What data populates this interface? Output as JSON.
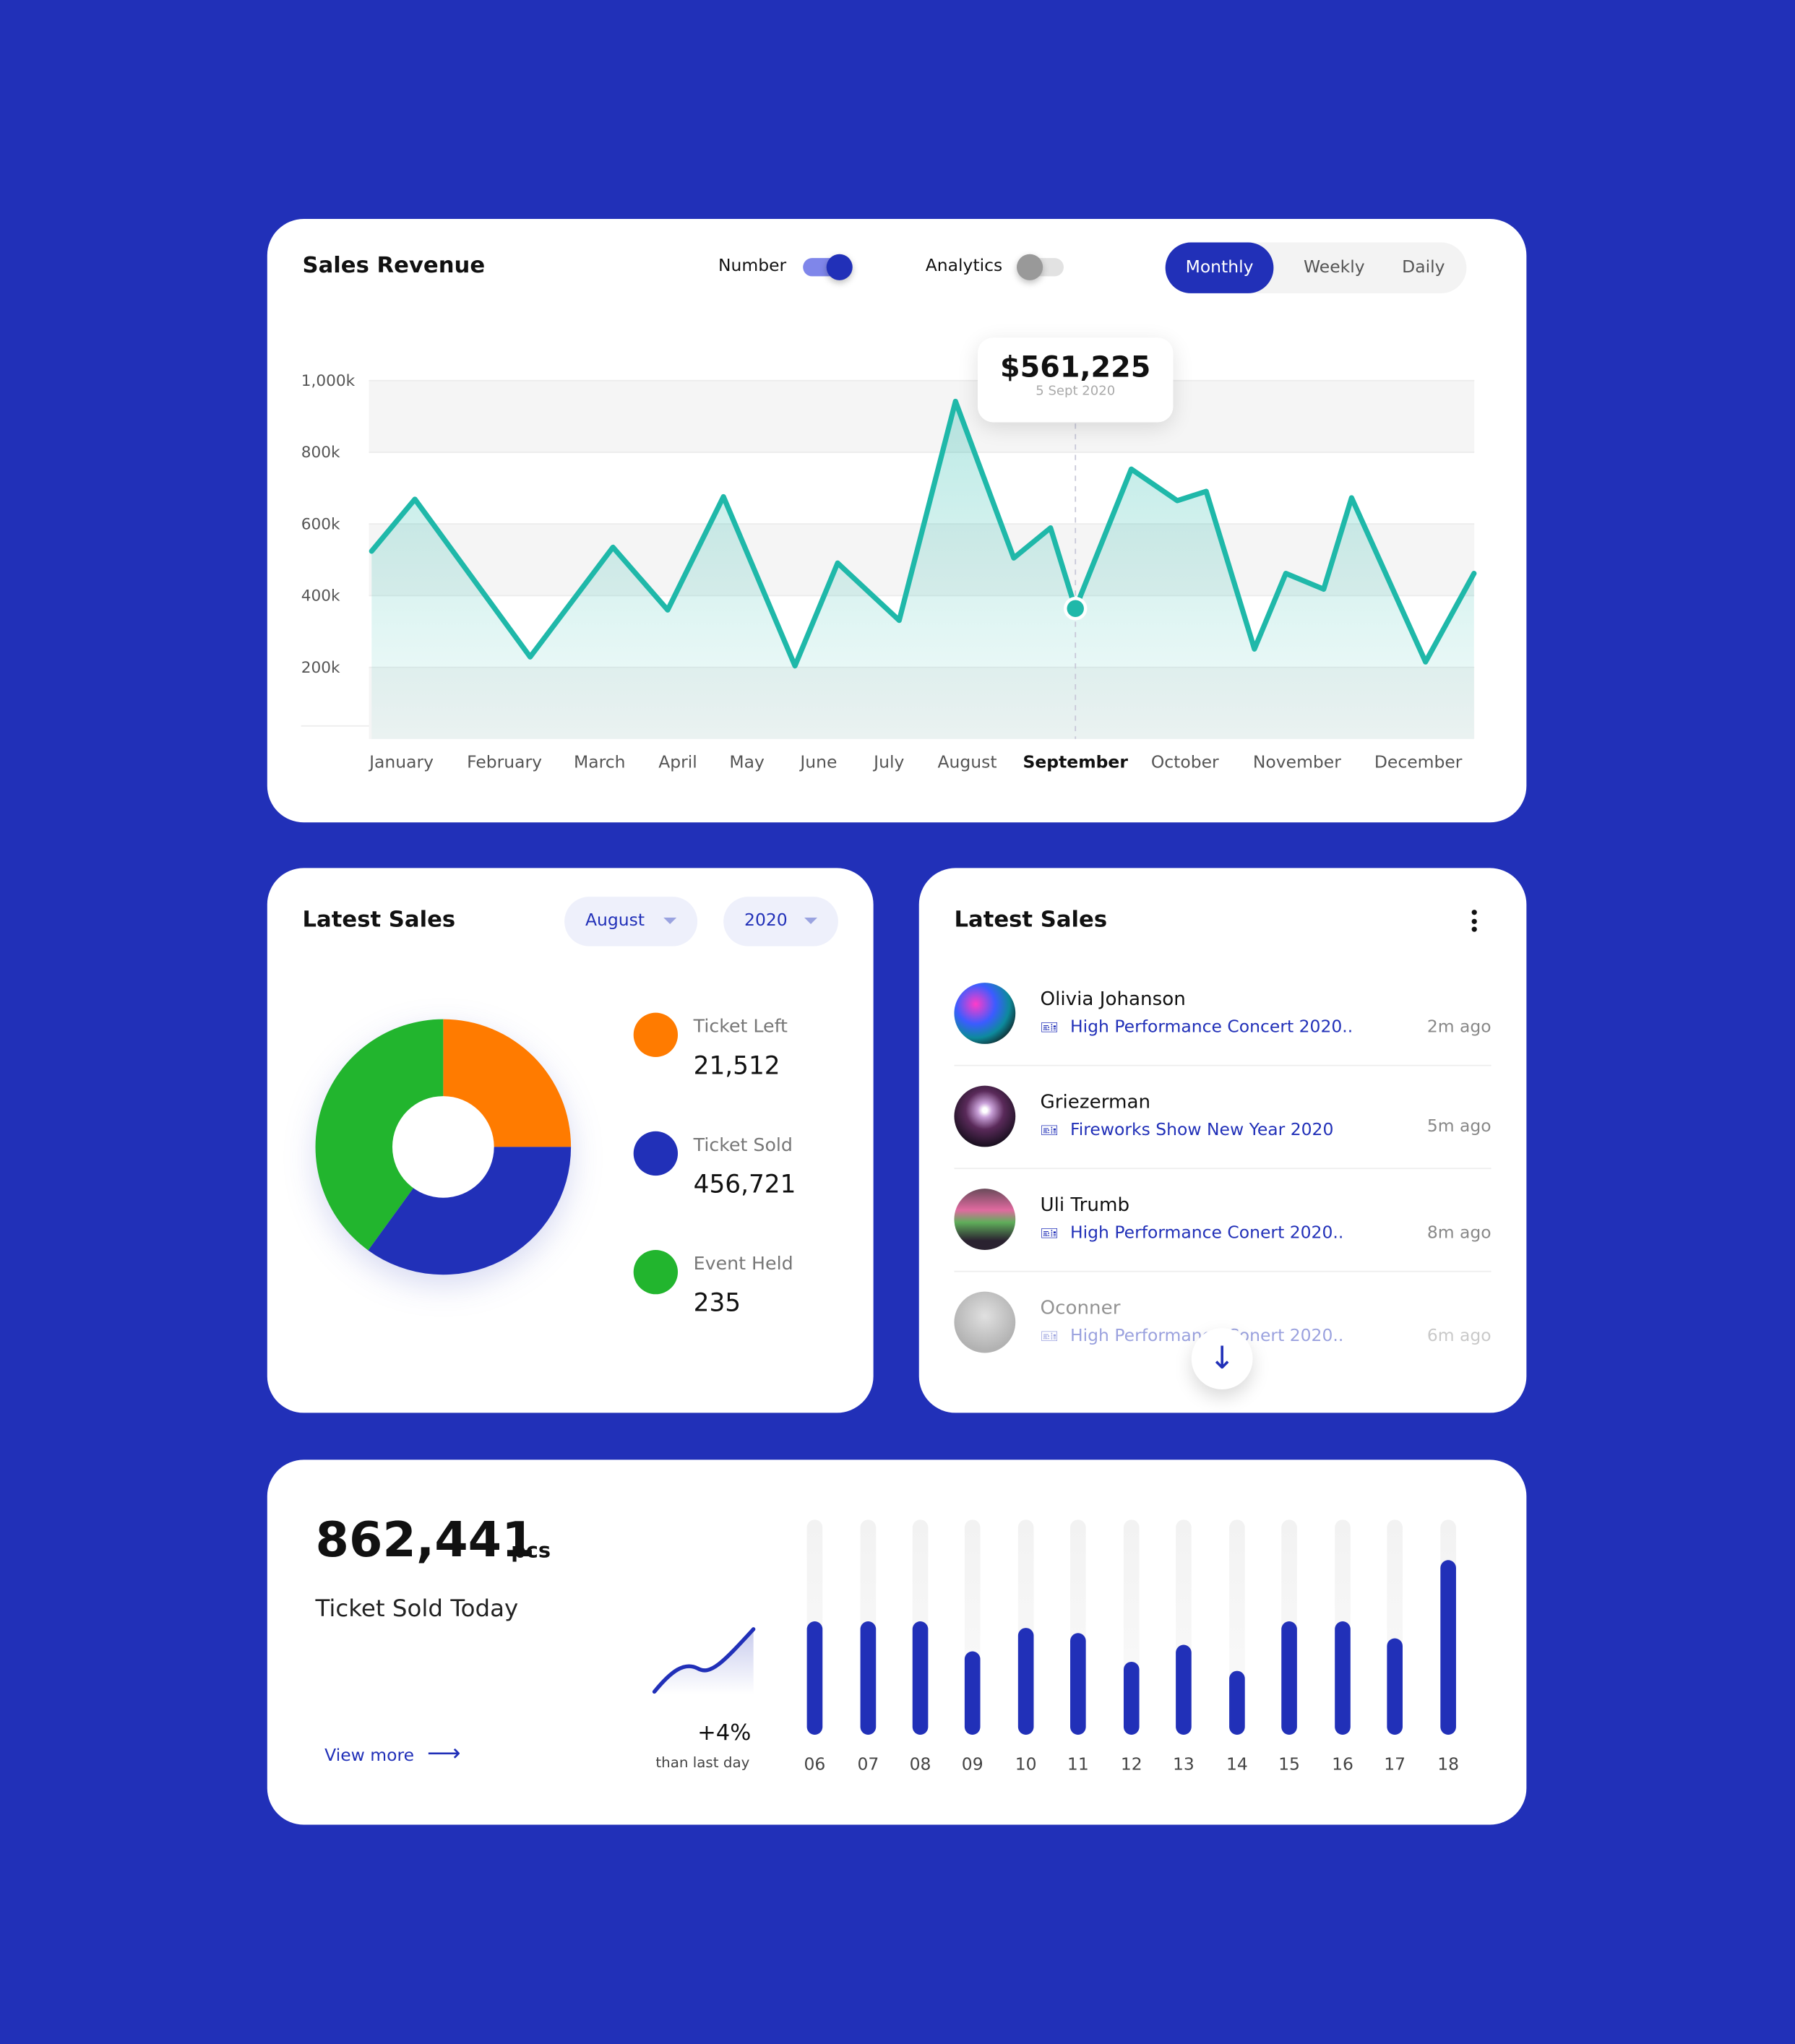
{
  "revenue": {
    "title": "Sales Revenue",
    "toggles": [
      {
        "label": "Number",
        "on": true
      },
      {
        "label": "Analytics",
        "on": false
      }
    ],
    "periods": [
      "Monthly",
      "Weekly",
      "Daily"
    ],
    "active_period": "Monthly",
    "tooltip": {
      "value": "$561,225",
      "date": "5 Sept 2020"
    },
    "colors": {
      "line": "#1fb8a9",
      "accent": "#2130b8"
    }
  },
  "chart_data": [
    {
      "type": "area",
      "y_ticks": [
        "1,000k",
        "800k",
        "600k",
        "400k",
        "200k"
      ],
      "ylim": [
        0,
        1000000
      ],
      "categories": [
        "January",
        "February",
        "March",
        "April",
        "May",
        "June",
        "July",
        "August",
        "September",
        "October",
        "November",
        "December"
      ],
      "highlight_category": "September",
      "series": [
        {
          "x_month_index": [
            -0.29,
            0.13,
            1.27,
            2.17,
            2.87,
            3.66,
            4.67,
            5.27,
            6.13,
            6.85,
            7.43,
            7.77,
            8.0,
            8.51,
            8.93,
            9.19,
            9.62,
            9.9,
            10.22,
            10.45,
            11.06,
            11.46
          ],
          "values": [
            524000,
            669000,
            229000,
            535000,
            360000,
            676000,
            204000,
            491000,
            331000,
            942000,
            505000,
            589000,
            364000,
            753000,
            665000,
            691000,
            251000,
            462000,
            418000,
            673000,
            215000,
            462000
          ]
        }
      ],
      "marker_index": 12,
      "grid": true
    },
    {
      "type": "pie",
      "donut": true,
      "slices": [
        {
          "label": "Ticket Left",
          "fraction": 0.25,
          "color": "#ff7b00"
        },
        {
          "label": "Ticket Sold",
          "fraction": 0.35,
          "color": "#2130b8"
        },
        {
          "label": "Event Held",
          "fraction": 0.4,
          "color": "#22b52e"
        }
      ]
    },
    {
      "type": "bar",
      "categories": [
        "06",
        "07",
        "08",
        "09",
        "10",
        "11",
        "12",
        "13",
        "14",
        "15",
        "16",
        "17",
        "18"
      ],
      "values": [
        0.53,
        0.53,
        0.53,
        0.39,
        0.5,
        0.47,
        0.34,
        0.42,
        0.3,
        0.53,
        0.53,
        0.45,
        0.81
      ],
      "ylim": [
        0,
        1
      ]
    }
  ],
  "latest_sales_left": {
    "title": "Latest Sales",
    "month": "August",
    "year": "2020",
    "legend": [
      {
        "label": "Ticket Left",
        "value": "21,512"
      },
      {
        "label": "Ticket Sold",
        "value": "456,721"
      },
      {
        "label": "Event Held",
        "value": "235"
      }
    ]
  },
  "latest_sales_right": {
    "title": "Latest Sales",
    "items": [
      {
        "name": "Olivia Johanson",
        "event": "High Performance Concert 2020..",
        "time": "2m ago"
      },
      {
        "name": "Griezerman",
        "event": "Fireworks Show New Year 2020",
        "time": "5m ago"
      },
      {
        "name": "Uli Trumb",
        "event": "High Performance Conert 2020..",
        "time": "8m ago"
      },
      {
        "name": "Oconner",
        "event": "High Performance Conert 2020..",
        "time": "6m ago"
      }
    ]
  },
  "today": {
    "count": "862,441",
    "unit": "pcs",
    "label": "Ticket Sold Today",
    "view_more": "View more",
    "change": "+4%",
    "change_label": "than last day"
  }
}
